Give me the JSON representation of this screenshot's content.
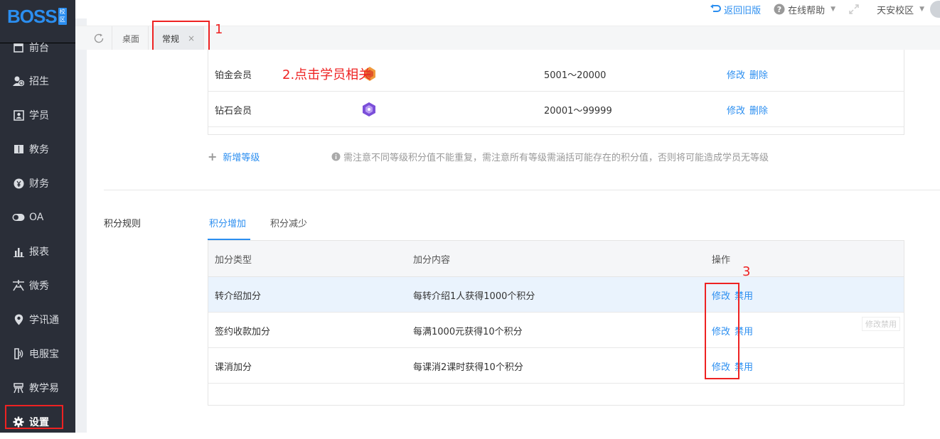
{
  "app": {
    "logo_text": "BOSS",
    "logo_tag": "校区"
  },
  "sidebar": {
    "items": [
      {
        "label": "前台",
        "icon": "calendar-icon"
      },
      {
        "label": "招生",
        "icon": "user-add-icon"
      },
      {
        "label": "学员",
        "icon": "id-card-icon"
      },
      {
        "label": "教务",
        "icon": "book-icon"
      },
      {
        "label": "财务",
        "icon": "yen-icon"
      },
      {
        "label": "OA",
        "icon": "toggle-icon"
      },
      {
        "label": "报表",
        "icon": "bar-chart-icon"
      },
      {
        "label": "微秀",
        "icon": "weixiu-icon"
      },
      {
        "label": "学讯通",
        "icon": "location-icon"
      },
      {
        "label": "电服宝",
        "icon": "phone-icon"
      },
      {
        "label": "教学易",
        "icon": "teach-icon"
      },
      {
        "label": "设置",
        "icon": "gear-icon"
      }
    ],
    "active": "设置"
  },
  "topbar": {
    "back_old": "返回旧版",
    "help": "在线帮助",
    "campus": "天安校区"
  },
  "tabs": [
    {
      "label": "桌面"
    },
    {
      "label": "常规",
      "close": "×"
    }
  ],
  "annotations": {
    "a1": "1",
    "a2": "2.点击学员相关",
    "a3": "3"
  },
  "levels": {
    "rows": [
      {
        "name": "铂金会员",
        "icon": "platinum-badge-icon",
        "range": "5001～20000",
        "edit": "修改",
        "delete": "删除"
      },
      {
        "name": "钻石会员",
        "icon": "diamond-badge-icon",
        "range": "20001～99999",
        "edit": "修改",
        "delete": "删除"
      }
    ],
    "add_label": "新增等级",
    "note": "需注意不同等级积分值不能重复，需注意所有等级需涵括可能存在的积分值，否则将可能造成学员无等级"
  },
  "points_rules": {
    "section_label": "积分规则",
    "tabs": [
      "积分增加",
      "积分减少"
    ],
    "active_tab": "积分增加",
    "columns": [
      "加分类型",
      "加分内容",
      "操作"
    ],
    "rows": [
      {
        "type": "转介绍加分",
        "content": "每转介绍1人获得1000个积分",
        "edit": "修改",
        "disable": "禁用"
      },
      {
        "type": "签约收款加分",
        "content": "每满1000元获得10个积分",
        "edit": "修改",
        "disable": "禁用"
      },
      {
        "type": "课消加分",
        "content": "每课消2课时获得10个积分",
        "edit": "修改",
        "disable": "禁用"
      }
    ],
    "tooltip": "修改禁用"
  },
  "colors": {
    "accent": "#2b8ef0",
    "sidebar_bg": "#2a2e38",
    "annotation_red": "#e22222"
  }
}
